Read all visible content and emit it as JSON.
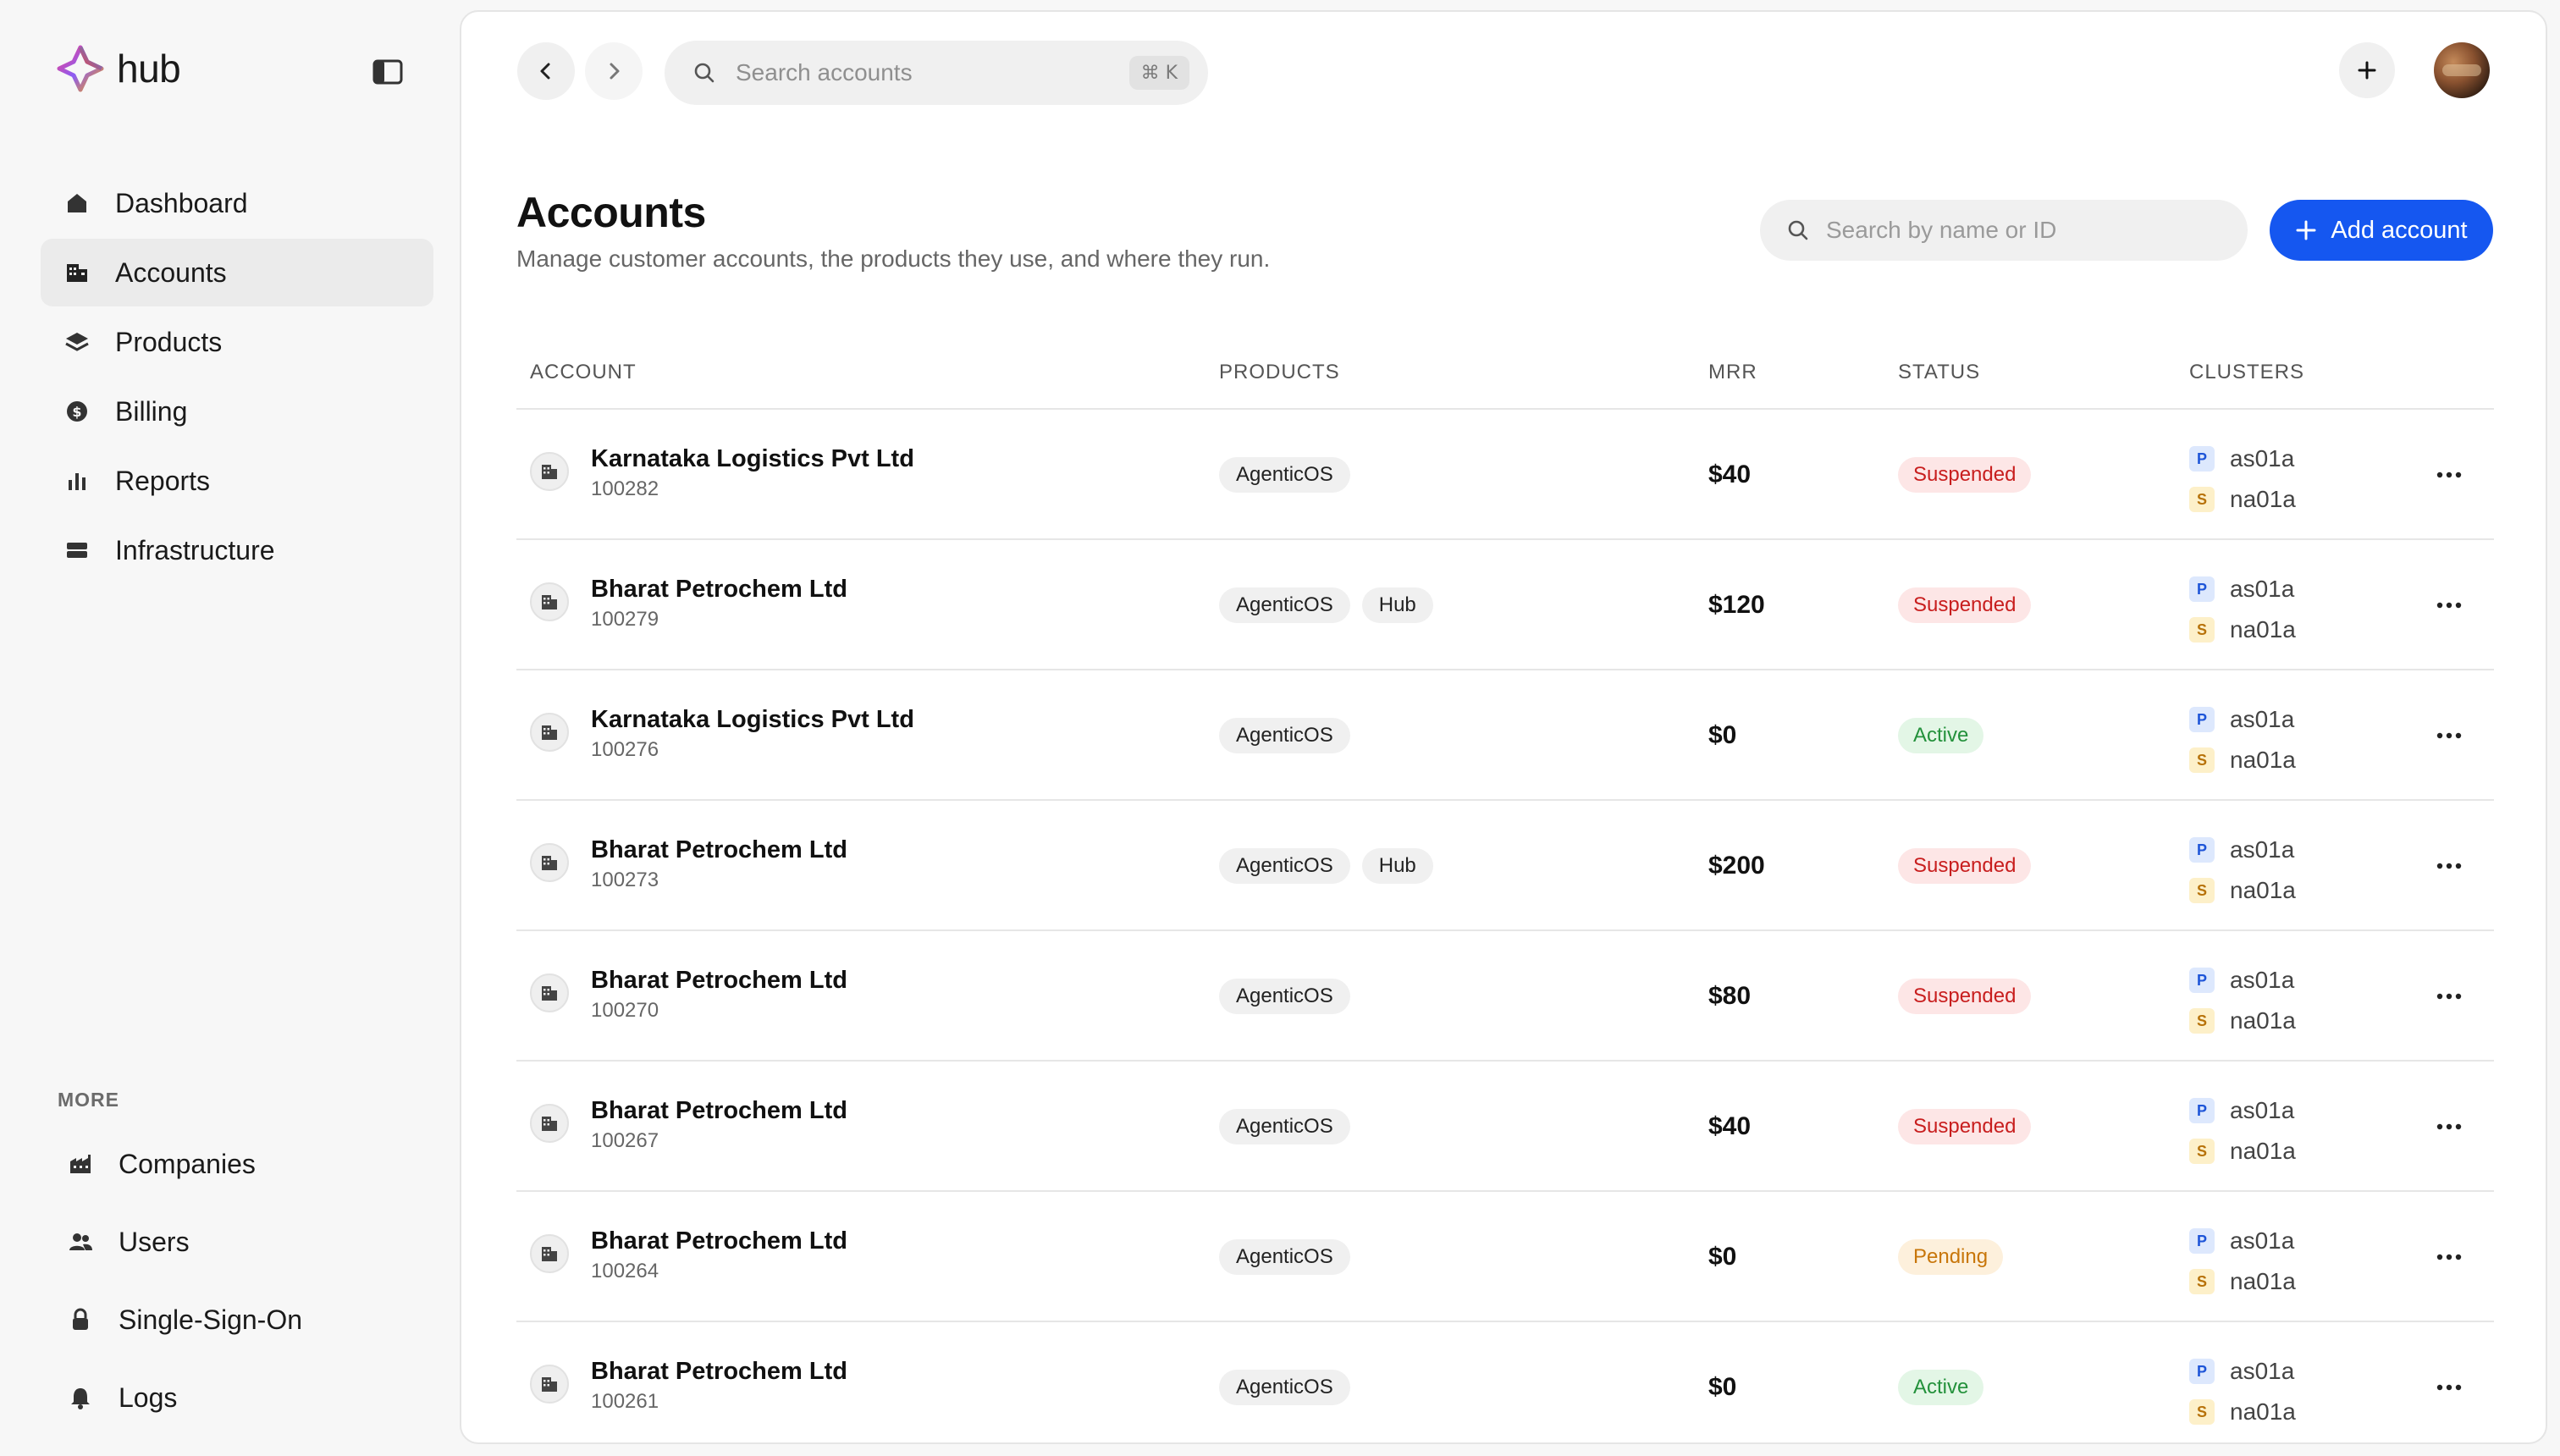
{
  "app": {
    "name": "hub"
  },
  "nav": {
    "items": [
      {
        "label": "Dashboard",
        "icon": "home-icon"
      },
      {
        "label": "Accounts",
        "icon": "building-icon",
        "active": true
      },
      {
        "label": "Products",
        "icon": "layers-icon"
      },
      {
        "label": "Billing",
        "icon": "dollar-circle-icon"
      },
      {
        "label": "Reports",
        "icon": "bar-chart-icon"
      },
      {
        "label": "Infrastructure",
        "icon": "server-icon"
      }
    ],
    "more_title": "MORE",
    "more_items": [
      {
        "label": "Companies",
        "icon": "factory-icon"
      },
      {
        "label": "Users",
        "icon": "users-icon"
      },
      {
        "label": "Single-Sign-On",
        "icon": "lock-icon"
      },
      {
        "label": "Logs",
        "icon": "bell-icon"
      }
    ]
  },
  "topbar": {
    "search_placeholder": "Search accounts",
    "shortcut": "⌘ K"
  },
  "page": {
    "title": "Accounts",
    "subtitle": "Manage customer accounts, the products they use, and where they run.",
    "filter_placeholder": "Search by name or ID",
    "add_label": "Add account"
  },
  "colors": {
    "accent": "#1557f0",
    "suspended": "#c81e1e",
    "active": "#23913b",
    "pending": "#c8760a"
  },
  "table": {
    "columns": [
      "ACCOUNT",
      "PRODUCTS",
      "MRR",
      "STATUS",
      "CLUSTERS"
    ],
    "rows": [
      {
        "name": "Karnataka Logistics Pvt Ltd",
        "id": "100282",
        "products": [
          "AgenticOS"
        ],
        "mrr": "$40",
        "status": "Suspended",
        "clusters": [
          {
            "tag": "P",
            "name": "as01a"
          },
          {
            "tag": "S",
            "name": "na01a"
          }
        ]
      },
      {
        "name": "Bharat Petrochem Ltd",
        "id": "100279",
        "products": [
          "AgenticOS",
          "Hub"
        ],
        "mrr": "$120",
        "status": "Suspended",
        "clusters": [
          {
            "tag": "P",
            "name": "as01a"
          },
          {
            "tag": "S",
            "name": "na01a"
          }
        ]
      },
      {
        "name": "Karnataka Logistics Pvt Ltd",
        "id": "100276",
        "products": [
          "AgenticOS"
        ],
        "mrr": "$0",
        "status": "Active",
        "clusters": [
          {
            "tag": "P",
            "name": "as01a"
          },
          {
            "tag": "S",
            "name": "na01a"
          }
        ]
      },
      {
        "name": "Bharat Petrochem Ltd",
        "id": "100273",
        "products": [
          "AgenticOS",
          "Hub"
        ],
        "mrr": "$200",
        "status": "Suspended",
        "clusters": [
          {
            "tag": "P",
            "name": "as01a"
          },
          {
            "tag": "S",
            "name": "na01a"
          }
        ]
      },
      {
        "name": "Bharat Petrochem Ltd",
        "id": "100270",
        "products": [
          "AgenticOS"
        ],
        "mrr": "$80",
        "status": "Suspended",
        "clusters": [
          {
            "tag": "P",
            "name": "as01a"
          },
          {
            "tag": "S",
            "name": "na01a"
          }
        ]
      },
      {
        "name": "Bharat Petrochem Ltd",
        "id": "100267",
        "products": [
          "AgenticOS"
        ],
        "mrr": "$40",
        "status": "Suspended",
        "clusters": [
          {
            "tag": "P",
            "name": "as01a"
          },
          {
            "tag": "S",
            "name": "na01a"
          }
        ]
      },
      {
        "name": "Bharat Petrochem Ltd",
        "id": "100264",
        "products": [
          "AgenticOS"
        ],
        "mrr": "$0",
        "status": "Pending",
        "clusters": [
          {
            "tag": "P",
            "name": "as01a"
          },
          {
            "tag": "S",
            "name": "na01a"
          }
        ]
      },
      {
        "name": "Bharat Petrochem Ltd",
        "id": "100261",
        "products": [
          "AgenticOS"
        ],
        "mrr": "$0",
        "status": "Active",
        "clusters": [
          {
            "tag": "P",
            "name": "as01a"
          },
          {
            "tag": "S",
            "name": "na01a"
          }
        ]
      }
    ]
  }
}
